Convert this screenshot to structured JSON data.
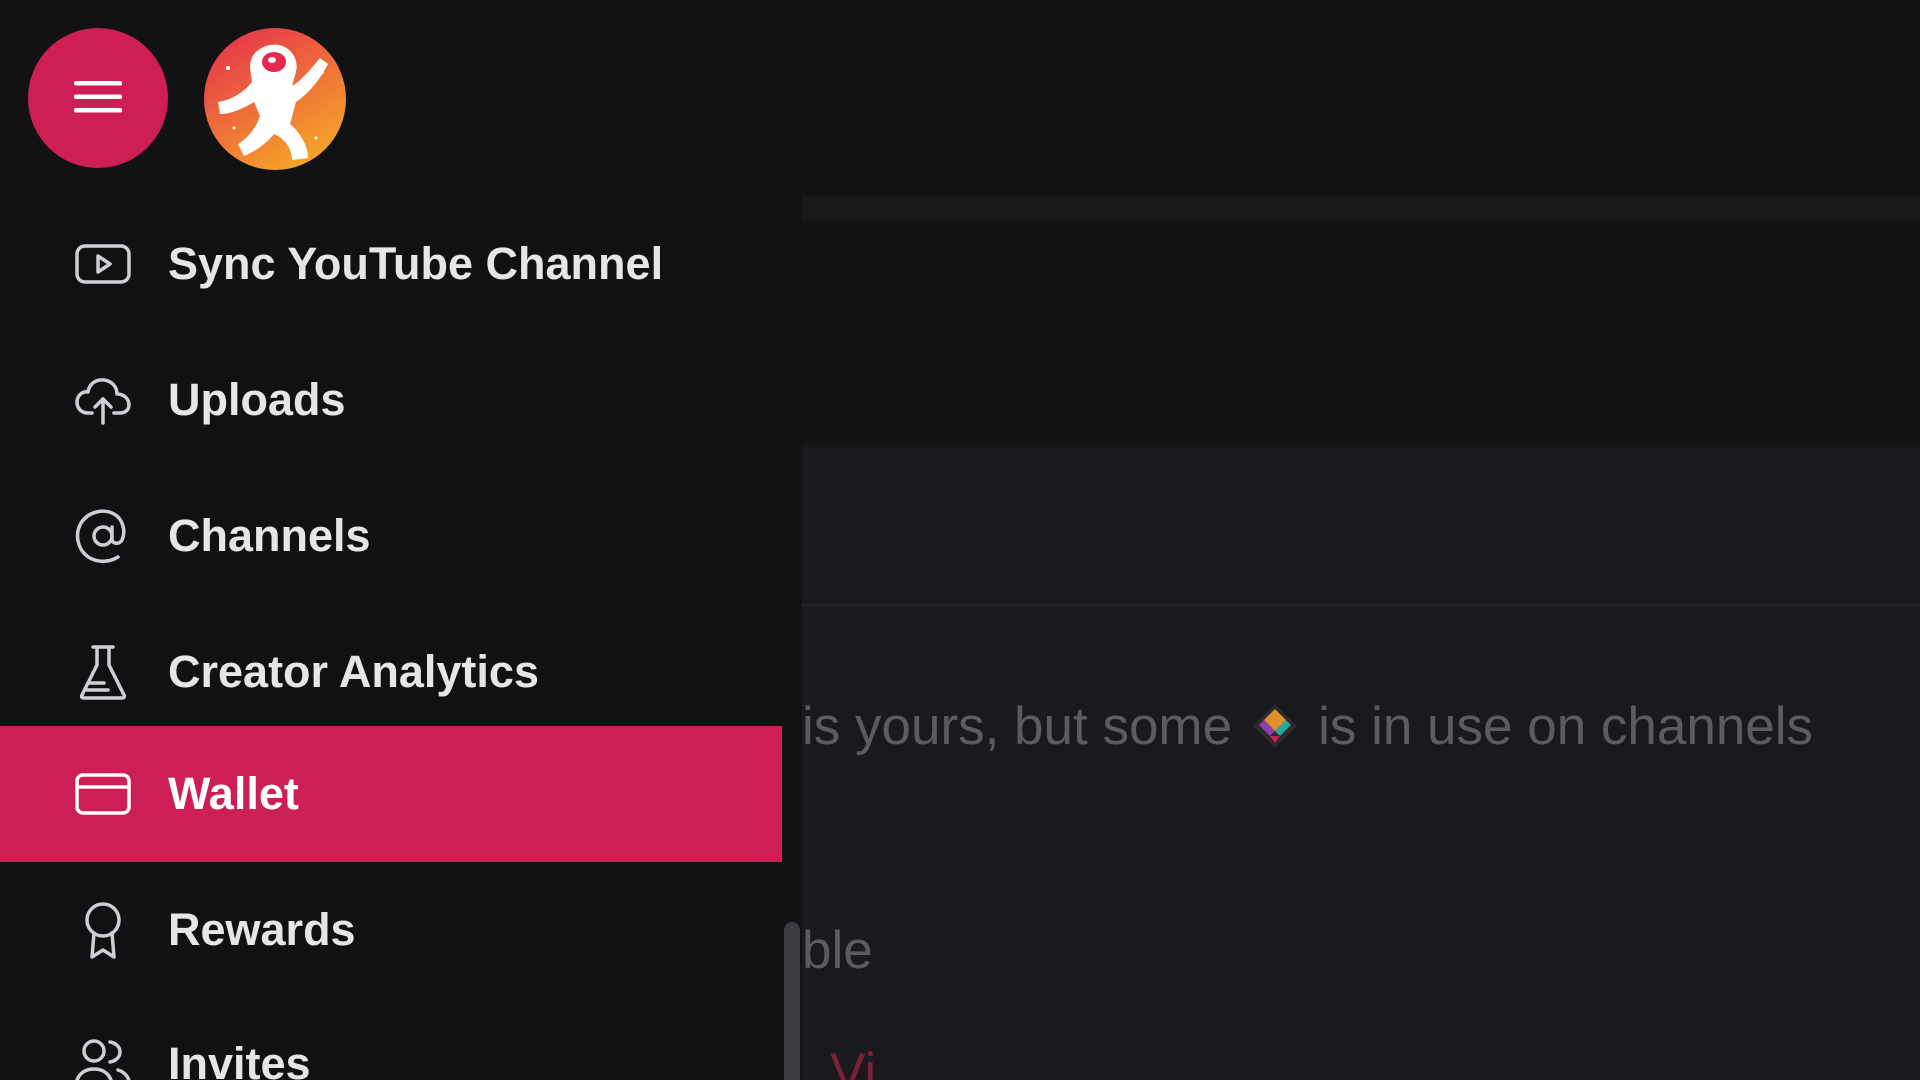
{
  "header": {
    "menu_icon": "hamburger-icon",
    "avatar_icon": "astronaut-avatar"
  },
  "sidebar": {
    "items": [
      {
        "label": "Sync YouTube Channel",
        "icon": "youtube-icon",
        "active": false
      },
      {
        "label": "Uploads",
        "icon": "cloud-upload-icon",
        "active": false
      },
      {
        "label": "Channels",
        "icon": "at-sign-icon",
        "active": false
      },
      {
        "label": "Creator Analytics",
        "icon": "flask-icon",
        "active": false
      },
      {
        "label": "Wallet",
        "icon": "credit-card-icon",
        "active": true
      },
      {
        "label": "Rewards",
        "icon": "award-icon",
        "active": false
      },
      {
        "label": "Invites",
        "icon": "users-icon",
        "active": false
      }
    ]
  },
  "main": {
    "line1_before": "is yours, but some",
    "line1_after": "is in use on channels",
    "line2": "ble",
    "line3": "Vi"
  },
  "colors": {
    "accent": "#cd1f54",
    "background": "#121214",
    "text": "#e6e6e9"
  }
}
